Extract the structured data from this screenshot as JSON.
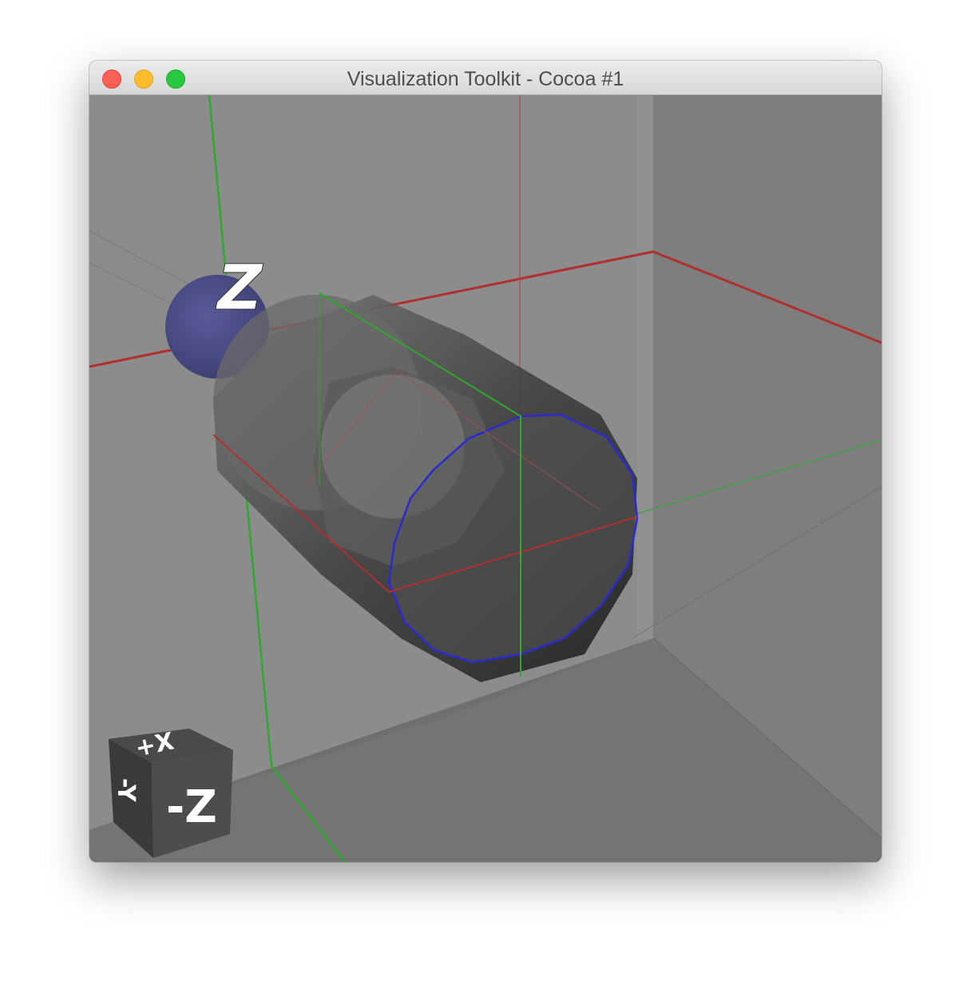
{
  "window": {
    "title": "Visualization Toolkit - Cocoa #1"
  },
  "viewport": {
    "background_color": "#8a8a8a",
    "axis_label": "Z",
    "orientation_cube": {
      "face_front_label": "-Z",
      "face_top_label": "+X",
      "face_side_label": "-Y"
    }
  },
  "colors": {
    "x_axis": "#b03030",
    "y_axis": "#2fa82f",
    "z_outline": "#2a2ad0",
    "sphere": "#4a4a80",
    "cube_face": "#3a3a3a"
  }
}
